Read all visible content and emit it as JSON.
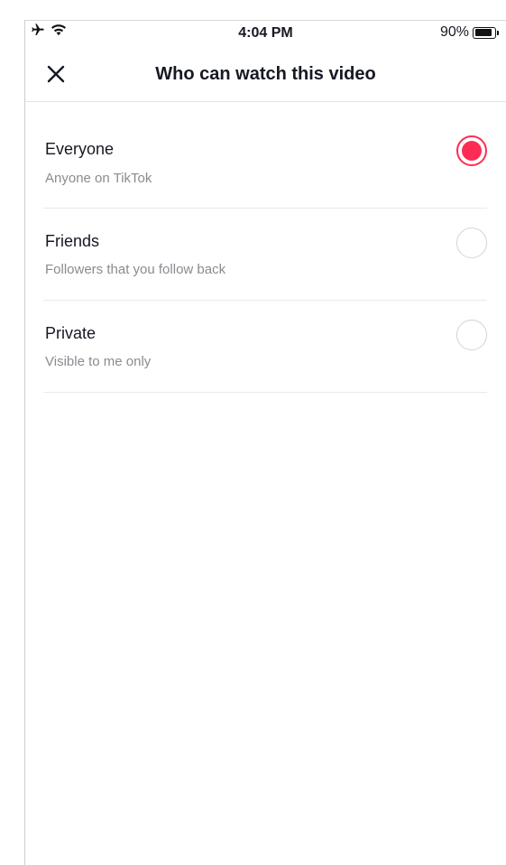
{
  "status_bar": {
    "time": "4:04 PM",
    "battery_percent": "90%",
    "battery_level": 0.9,
    "icons": [
      "airplane-icon",
      "wifi-icon",
      "battery-icon"
    ]
  },
  "nav": {
    "title": "Who can watch this video",
    "close_icon": "close-icon"
  },
  "options": [
    {
      "label": "Everyone",
      "description": "Anyone on TikTok",
      "selected": true
    },
    {
      "label": "Friends",
      "description": "Followers that you follow back",
      "selected": false
    },
    {
      "label": "Private",
      "description": "Visible to me only",
      "selected": false
    }
  ],
  "colors": {
    "accent": "#fe2c55",
    "text": "#161823",
    "secondary_text": "#8a8b91",
    "radio_border": "#d3d3d6"
  }
}
